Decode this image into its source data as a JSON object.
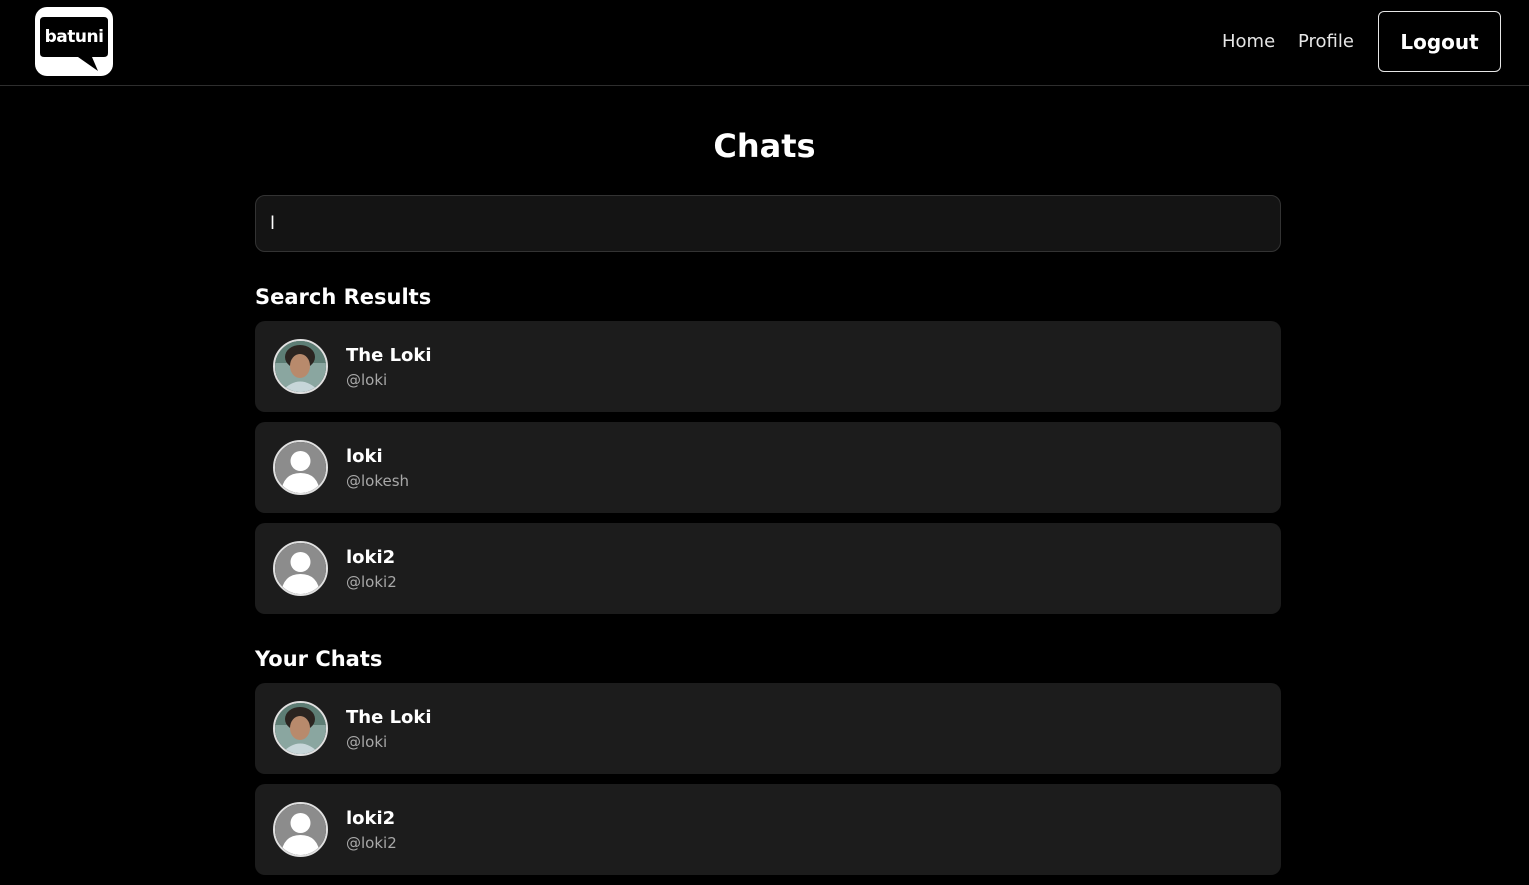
{
  "nav": {
    "logo_text": "batuni",
    "home_label": "Home",
    "profile_label": "Profile",
    "logout_label": "Logout"
  },
  "main": {
    "title": "Chats",
    "search": {
      "value": "l",
      "placeholder": ""
    }
  },
  "search_results": {
    "title": "Search Results",
    "items": [
      {
        "name": "The Loki",
        "handle": "@loki",
        "avatar": "photo"
      },
      {
        "name": "loki",
        "handle": "@lokesh",
        "avatar": "default-user-icon"
      },
      {
        "name": "loki2",
        "handle": "@loki2",
        "avatar": "default-user-icon"
      }
    ]
  },
  "your_chats": {
    "title": "Your Chats",
    "items": [
      {
        "name": "The Loki",
        "handle": "@loki",
        "avatar": "photo"
      },
      {
        "name": "loki2",
        "handle": "@loki2",
        "avatar": "default-user-icon"
      }
    ]
  },
  "colors": {
    "background": "#000000",
    "card": "#1c1c1c",
    "input": "#141414",
    "muted_text": "#a8a8a8"
  }
}
